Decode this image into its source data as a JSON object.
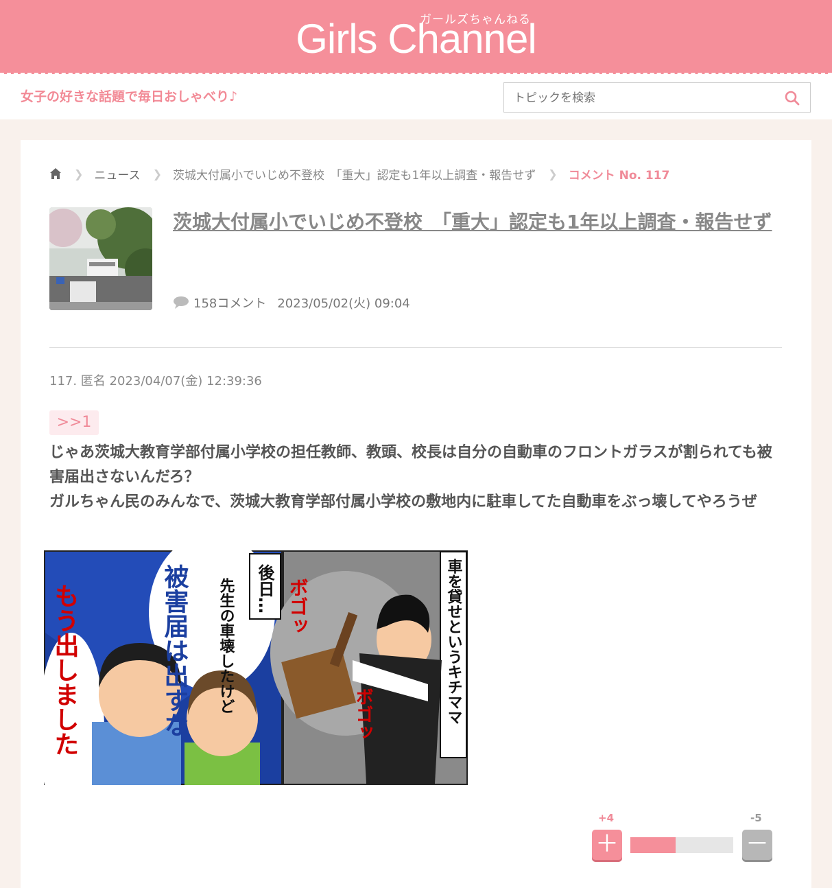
{
  "header": {
    "logo_sub": "ガールズちゃんねる",
    "logo": "Girls Channel",
    "tagline": "女子の好きな話題で毎日おしゃべり♪",
    "search_placeholder": "トピックを検索"
  },
  "breadcrumb": {
    "home_icon": "home-icon",
    "items": [
      "ニュース",
      "茨城大付属小でいじめ不登校　「重大」認定も1年以上調査・報告せず"
    ],
    "current": "コメント No. 117"
  },
  "topic": {
    "title": "茨城大付属小でいじめ不登校　「重大」認定も1年以上調査・報告せず",
    "comments": "158コメント",
    "date": "2023/05/02(火) 09:04"
  },
  "comment": {
    "header": "117. 匿名 2023/04/07(金) 12:39:36",
    "anchor": ">>1",
    "body_line1": "じゃあ茨城大教育学部付属小学校の担任教師、教頭、校長は自分の自動車のフロントガラスが割られても被害届出さないんだろ？",
    "body_line2": "ガルちゃん民のみんなで、茨城大教育学部付属小学校の敷地内に駐車してた自動車をぶっ壊してやろうぜ",
    "image_text": {
      "panel1_bubble_a": "先生の車壊したけど",
      "panel1_bubble_b": "被害届は出すな",
      "panel1_big": "もう出しました",
      "panel2_caption": "後日…",
      "panel2_right": "車を貸せというキチママ",
      "sfx1": "ボゴッ",
      "sfx2": "ボゴッ"
    }
  },
  "votes": {
    "plus": "+4",
    "minus": "-5",
    "plus_fraction": 0.44
  },
  "colors": {
    "brand": "#f58f9a",
    "accent_text": "#f08a98"
  }
}
